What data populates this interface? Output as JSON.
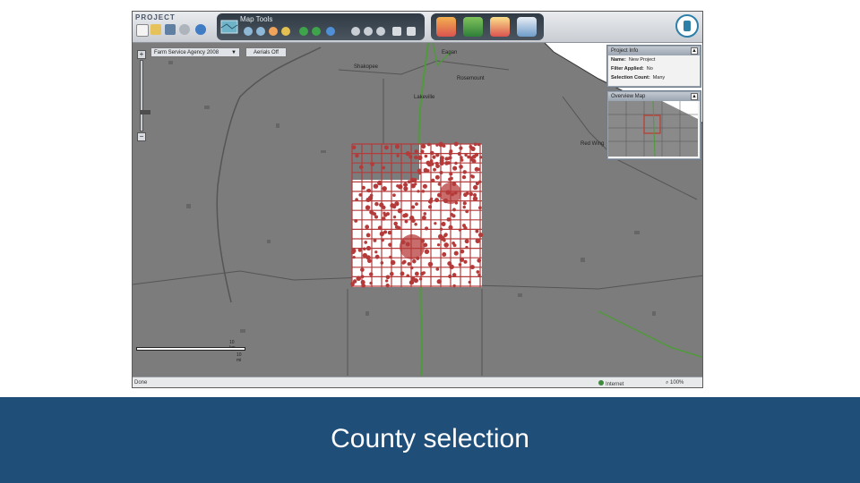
{
  "app": {
    "brand": "PROJECT",
    "map_tools_label": "Map Tools"
  },
  "layer_selector": {
    "value": "Farm Service Agency 2008",
    "aerials_button": "Aerials Off"
  },
  "project_info": {
    "title": "Project Info",
    "rows": [
      {
        "label": "Name:",
        "value": "New Project"
      },
      {
        "label": "Filter Applied:",
        "value": "No"
      },
      {
        "label": "Selection Count:",
        "value": "Many"
      }
    ]
  },
  "overview_map": {
    "title": "Overview Map",
    "collapse": "-"
  },
  "map_labels": {
    "shakopee": "Shakopee",
    "rosemount": "Rosemount",
    "lakeville": "Lakeville",
    "eagan": "Eagan",
    "red_wing": "Red Wing"
  },
  "scale": {
    "top": "10 km",
    "bottom": "10 mi"
  },
  "statusbar": {
    "left": "Done",
    "zone": "Internet",
    "zoom": "100%"
  },
  "caption": "County selection",
  "colors": {
    "footer": "#1f4e79",
    "selection_red": "#b53b3b",
    "selection_fill": "#ffffff",
    "map_gray": "#7c7c7c",
    "highway_green": "#4f9a3a"
  }
}
